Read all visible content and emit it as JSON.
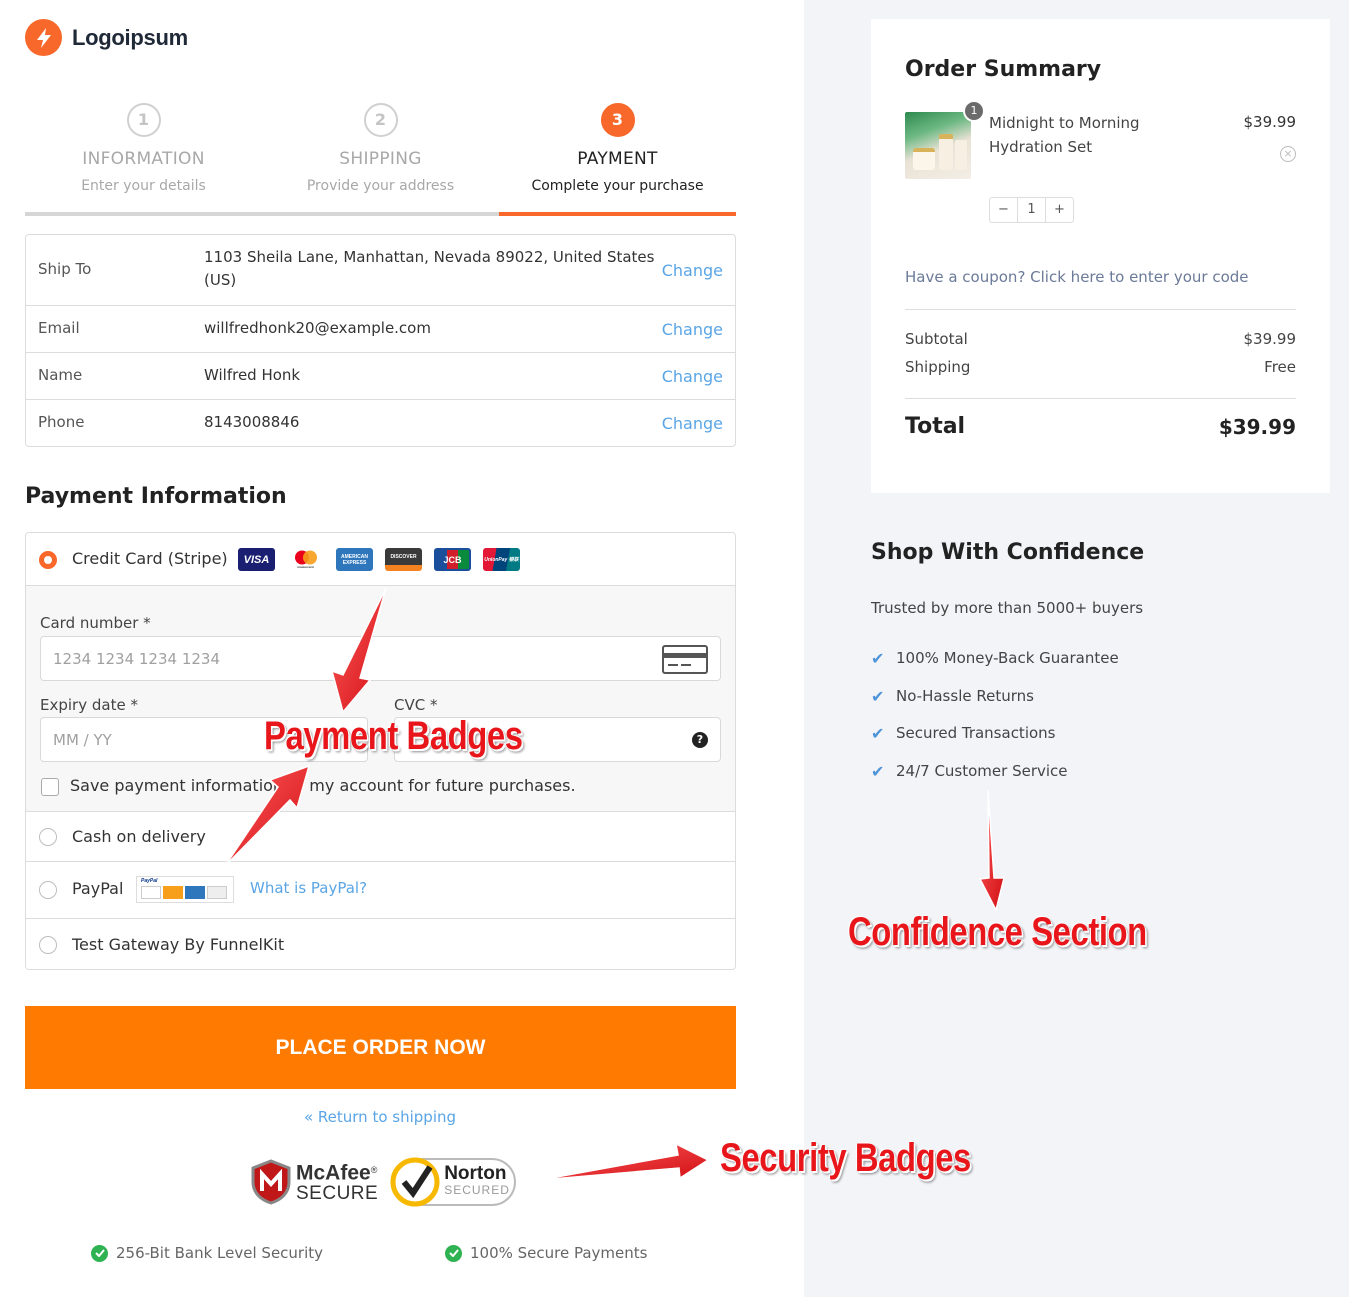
{
  "brand": {
    "name": "Logoipsum",
    "accent": "#f7682a",
    "link": "#5aa5e6",
    "button": "#ff7a00"
  },
  "steps": [
    {
      "num": "1",
      "title": "INFORMATION",
      "sub": "Enter your details"
    },
    {
      "num": "2",
      "title": "SHIPPING",
      "sub": "Provide your address"
    },
    {
      "num": "3",
      "title": "PAYMENT",
      "sub": "Complete your purchase"
    }
  ],
  "review": [
    {
      "label": "Ship To",
      "value": "1103 Sheila Lane, Manhattan, Nevada 89022, United States (US)",
      "action": "Change"
    },
    {
      "label": "Email",
      "value": "willfredhonk20@example.com",
      "action": "Change"
    },
    {
      "label": "Name",
      "value": "Wilfred Honk",
      "action": "Change"
    },
    {
      "label": "Phone",
      "value": "8143008846",
      "action": "Change"
    }
  ],
  "payment": {
    "heading": "Payment Information",
    "stripe": {
      "label": "Credit Card (Stripe)",
      "badges": [
        "VISA",
        "mastercard",
        "AMERICAN EXPRESS",
        "DISCOVER",
        "JCB",
        "UnionPay 银联"
      ],
      "card_number_label": "Card number *",
      "card_number_placeholder": "1234 1234 1234 1234",
      "expiry_label": "Expiry date *",
      "expiry_placeholder": "MM / YY",
      "cvc_label": "CVC *",
      "save_label": "Save payment information to my account for future purchases."
    },
    "cod_label": "Cash on delivery",
    "paypal_label": "PayPal",
    "paypal_badge_brand": "PayPal",
    "paypal_link": "What is PayPal?",
    "test_gateway_label": "Test Gateway By FunnelKit"
  },
  "place_order": "PLACE ORDER NOW",
  "return_link": "« Return to shipping",
  "security": {
    "mcafee_a": "McAfee",
    "mcafee_sup": "®",
    "mcafee_b": "SECURE",
    "norton_a": "Norton",
    "norton_b": "SECURED"
  },
  "trust": [
    "256-Bit Bank Level Security",
    "100% Secure Payments"
  ],
  "summary": {
    "title": "Order Summary",
    "product": "Midnight to Morning Hydration Set",
    "qty_badge": "1",
    "price": "$39.99",
    "qty": "1",
    "minus": "−",
    "plus": "+",
    "remove": "×",
    "coupon": "Have a coupon? Click here to enter your code",
    "subtotal_label": "Subtotal",
    "subtotal": "$39.99",
    "shipping_label": "Shipping",
    "shipping": "Free",
    "total_label": "Total",
    "total": "$39.99"
  },
  "confidence": {
    "title": "Shop With Confidence",
    "subtitle": "Trusted by more than 5000+ buyers",
    "items": [
      "100% Money-Back Guarantee",
      "No-Hassle Returns",
      "Secured Transactions",
      "24/7 Customer Service"
    ]
  },
  "annotations": {
    "payment_badges": "Payment Badges",
    "confidence_section": "Confidence Section",
    "security_badges": "Security Badges"
  }
}
